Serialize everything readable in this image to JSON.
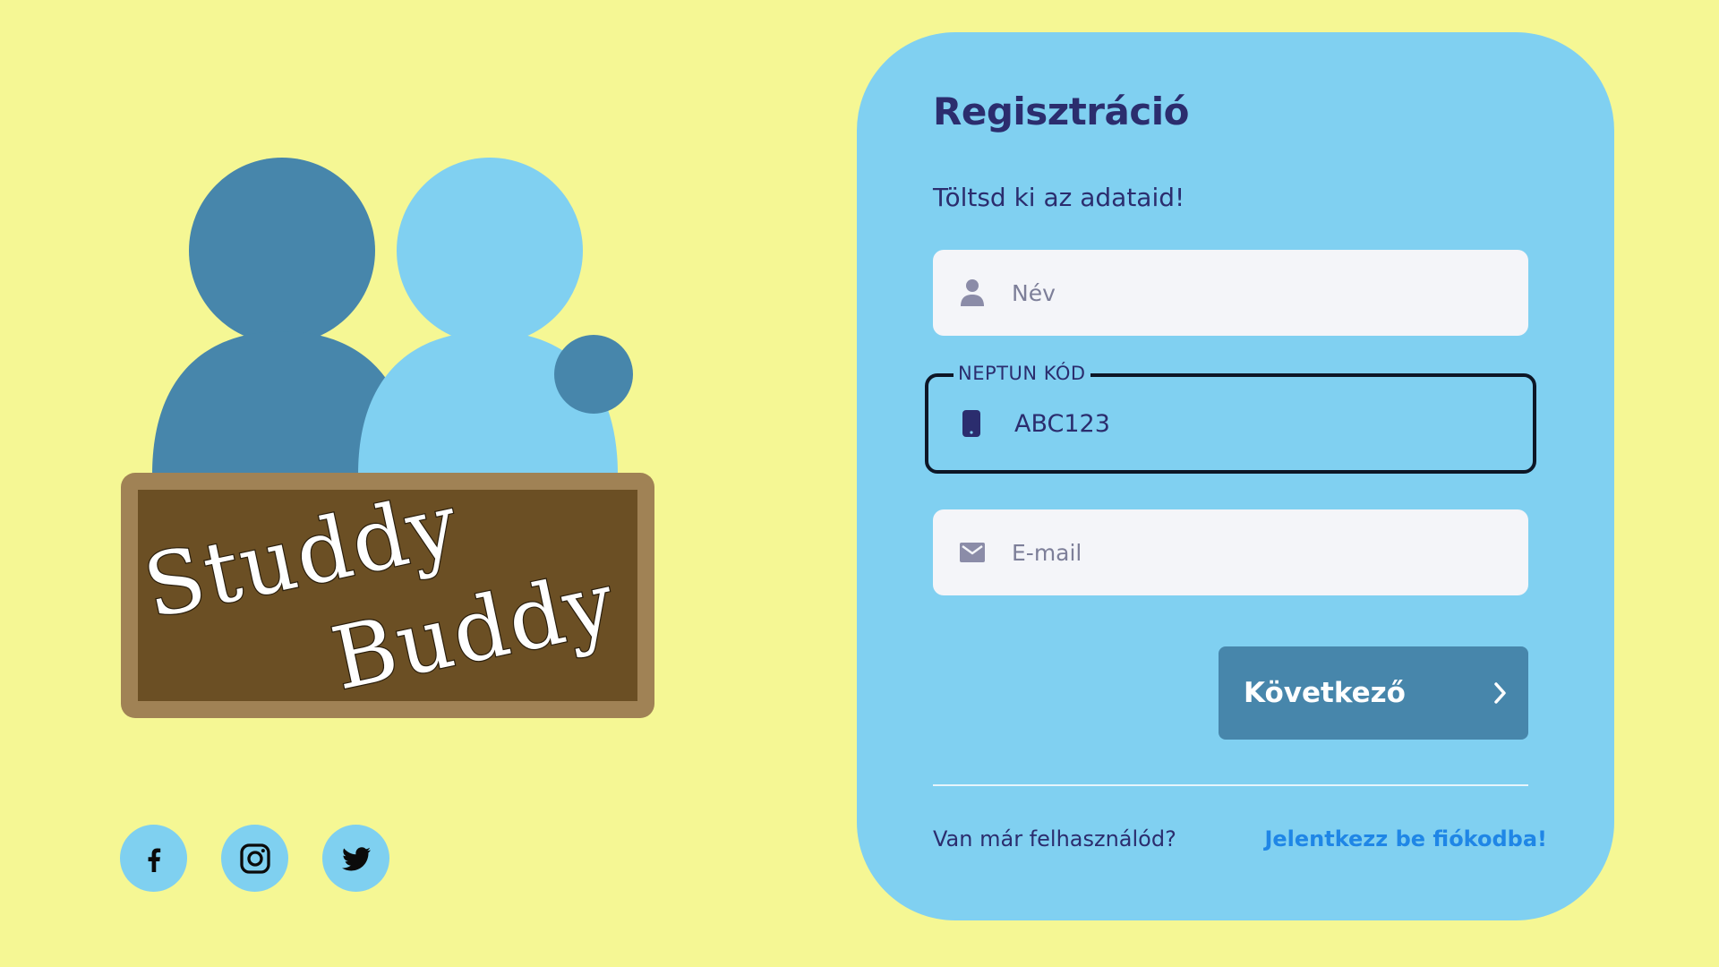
{
  "logo": {
    "line1": "Studdy",
    "line2": "Buddy",
    "colors": {
      "figure_dark": "#4786ab",
      "figure_light": "#80d0f1",
      "board_frame": "#a08255",
      "board_inner": "#6b4f24"
    }
  },
  "social": [
    {
      "name": "facebook",
      "icon": "facebook-icon"
    },
    {
      "name": "instagram",
      "icon": "instagram-icon"
    },
    {
      "name": "twitter",
      "icon": "twitter-icon"
    }
  ],
  "form": {
    "title": "Regisztráció",
    "subtitle": "Töltsd ki az adataid!",
    "name_field": {
      "placeholder": "Név",
      "value": "",
      "icon": "user-icon"
    },
    "neptun_field": {
      "label": "NEPTUN KÓD",
      "value": "ABC123",
      "icon": "phone-icon"
    },
    "email_field": {
      "placeholder": "E-mail",
      "value": "",
      "icon": "mail-icon"
    },
    "next_button": {
      "label": "Következő",
      "icon": "chevron-right-icon"
    },
    "footer_question": "Van már felhasználód?",
    "footer_link": "Jelentkezz be fiókodba!"
  },
  "colors": {
    "background": "#f5f794",
    "card": "#80d0f1",
    "primary_text": "#2b2d6e",
    "button": "#4786ab",
    "link": "#1f86e6"
  }
}
